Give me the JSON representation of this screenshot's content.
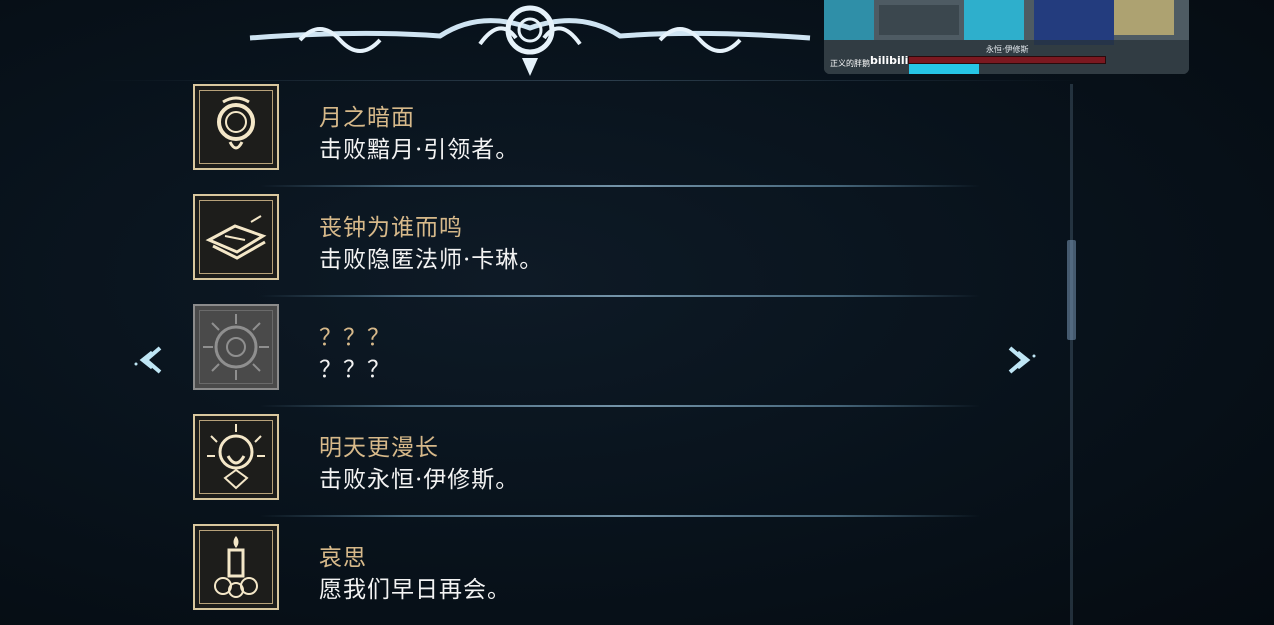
{
  "achievements": [
    {
      "title": "月之暗面",
      "description": "击败黯月·引领者。",
      "icon": "moon-ring-icon"
    },
    {
      "title": "丧钟为谁而鸣",
      "description": "击败隐匿法师·卡琳。",
      "icon": "open-book-icon"
    },
    {
      "title": "？？？",
      "description": "？？？",
      "icon": "locked-sun-icon"
    },
    {
      "title": "明天更漫长",
      "description": "击败永恒·伊修斯。",
      "icon": "radiant-skull-icon"
    },
    {
      "title": "哀思",
      "description": "愿我们早日再会。",
      "icon": "candle-roses-icon"
    }
  ],
  "video_overlay": {
    "channel": "正义的胖鹅",
    "platform": "bilibili",
    "boss_name": "永恒·伊修斯"
  },
  "colors": {
    "title_gold": "#d7b98a",
    "desc_white": "#f3f3f3",
    "frame_gold": "#d9c79e",
    "accent_cyan": "#9fd8ef"
  }
}
